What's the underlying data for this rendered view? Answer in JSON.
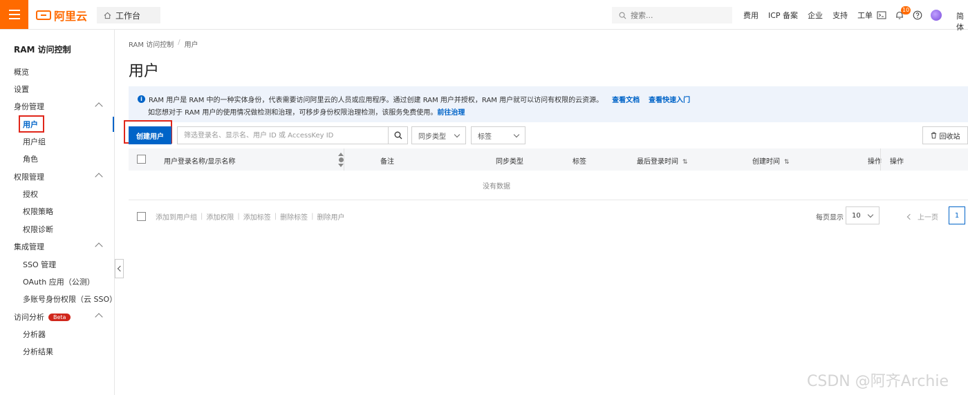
{
  "topbar": {
    "brand": "阿里云",
    "workbench": "工作台",
    "search_placeholder": "搜索...",
    "links": [
      "费用",
      "ICP 备案",
      "企业",
      "支持",
      "工单"
    ],
    "notification_count": "10",
    "lang": "简体"
  },
  "sidebar": {
    "title": "RAM 访问控制",
    "items": [
      {
        "label": "概览"
      },
      {
        "label": "设置"
      },
      {
        "label": "身份管理"
      },
      {
        "label": "用户"
      },
      {
        "label": "用户组"
      },
      {
        "label": "角色"
      },
      {
        "label": "权限管理"
      },
      {
        "label": "授权"
      },
      {
        "label": "权限策略"
      },
      {
        "label": "权限诊断"
      },
      {
        "label": "集成管理"
      },
      {
        "label": "SSO 管理"
      },
      {
        "label": "OAuth 应用（公测）"
      },
      {
        "label": "多账号身份权限（云 SSO）"
      },
      {
        "label": "访问分析"
      },
      {
        "label": "分析器"
      },
      {
        "label": "分析结果"
      }
    ],
    "beta_badge": "Beta"
  },
  "breadcrumb": [
    "RAM 访问控制",
    "/",
    "用户"
  ],
  "page_title": "用户",
  "info": {
    "line1": "RAM 用户是 RAM 中的一种实体身份，代表需要访问阿里云的人员或应用程序。通过创建 RAM 用户并授权，RAM 用户就可以访问有权限的云资源。",
    "link1": "查看文档",
    "link2": "查看快速入门",
    "line2": "如您想对于 RAM 用户的使用情况做检测和治理，可移步身份权限治理检测，该服务免费使用。",
    "link3": "前往治理"
  },
  "toolbar": {
    "create_button": "创建用户",
    "filter_placeholder": "筛选登录名、显示名、用户 ID 或 AccessKey ID",
    "sync_type": "同步类型",
    "tag": "标签",
    "recycle_bin": "回收站"
  },
  "table": {
    "columns": [
      "用户登录名称/显示名称",
      "备注",
      "同步类型",
      "标签",
      "最后登录时间",
      "创建时间",
      "操作",
      "操作"
    ],
    "sort_glyph": "⇅",
    "empty": "没有数据"
  },
  "bulk_actions": [
    "添加到用户组",
    "添加权限",
    "添加标签",
    "删除标签",
    "删除用户"
  ],
  "bulk_separator": "|",
  "pagination": {
    "per_page_label": "每页显示",
    "per_page_value": "10",
    "prev": "上一页",
    "current": "1"
  },
  "watermark": "CSDN @阿齐Archie",
  "colors": {
    "brand": "#ff6a00",
    "primary": "#0064c8",
    "highlight_box": "#e0261a"
  }
}
